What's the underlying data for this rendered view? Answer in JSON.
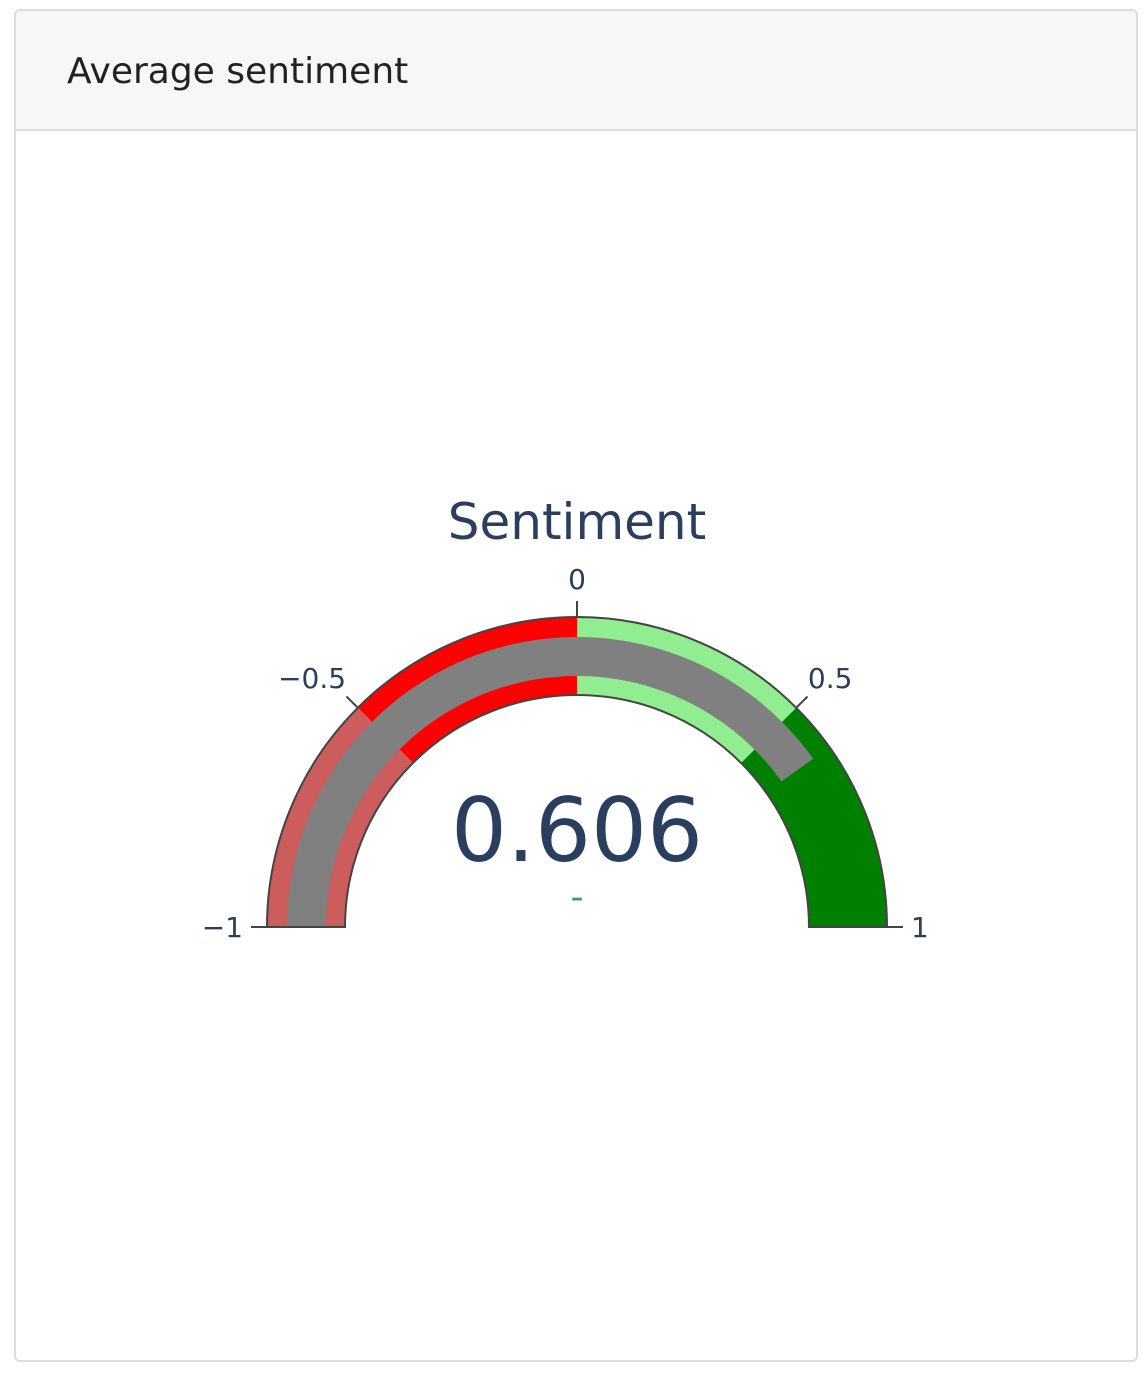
{
  "card": {
    "title": "Average sentiment"
  },
  "chart_data": {
    "type": "gauge",
    "title": "Sentiment",
    "value": 0.606,
    "value_label": "0.606",
    "delta_label": "-",
    "range": [
      -1,
      1
    ],
    "ticks": [
      {
        "value": -1,
        "label": "−1"
      },
      {
        "value": -0.5,
        "label": "−0.5"
      },
      {
        "value": 0,
        "label": "0"
      },
      {
        "value": 0.5,
        "label": "0.5"
      },
      {
        "value": 1,
        "label": "1"
      }
    ],
    "steps": [
      {
        "range": [
          -1,
          -0.5
        ],
        "color": "#cd5c5c"
      },
      {
        "range": [
          -0.5,
          0
        ],
        "color": "#ff0000"
      },
      {
        "range": [
          0,
          0.5
        ],
        "color": "#90ee90"
      },
      {
        "range": [
          0.5,
          1
        ],
        "color": "#008000"
      }
    ],
    "bar_color": "#808080",
    "text_color": "#2a3f5f",
    "delta_color": "#3d9970"
  }
}
